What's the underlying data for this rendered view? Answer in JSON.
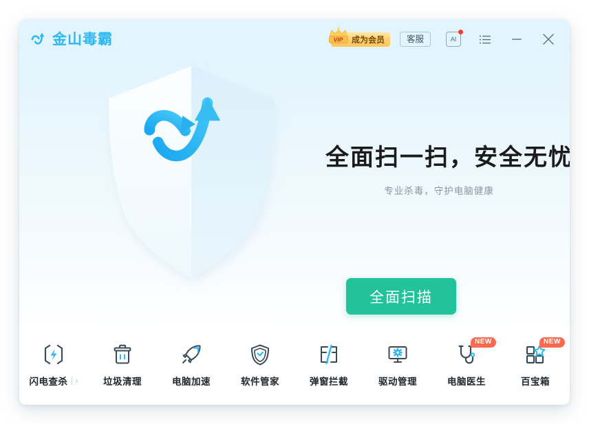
{
  "app": {
    "logo_text": "金山毒霸",
    "logo_icon": "duba-swoosh-icon",
    "accent_blue": "#2cb8f5",
    "accent_green": "#22c39a",
    "titlebar_bg": "#e2f4fd",
    "badge_red": "#fb6a4f"
  },
  "titlebar": {
    "vip_badge_text": "VIP",
    "vip_label": "成为会员",
    "support_label": "客服",
    "ai_label": "AI",
    "ai_has_notification": true,
    "menu_icon": "list-menu-icon",
    "minimize_icon": "minimize-icon",
    "close_icon": "close-icon"
  },
  "hero": {
    "title": "全面扫一扫，安全无忧",
    "subtitle": "专业杀毒，守护电脑健康",
    "scan_button": "全面扫描",
    "illustration": "shield-with-swoosh-arrow"
  },
  "toolbar": {
    "items": [
      {
        "label": "闪电查杀",
        "icon": "lightning-hexagon-icon",
        "badge": "",
        "has_chevron": true,
        "chevron": "›"
      },
      {
        "label": "垃圾清理",
        "icon": "trash-bin-icon",
        "badge": "",
        "has_chevron": false,
        "chevron": ""
      },
      {
        "label": "电脑加速",
        "icon": "rocket-icon",
        "badge": "",
        "has_chevron": false,
        "chevron": ""
      },
      {
        "label": "软件管家",
        "icon": "shield-check-icon",
        "badge": "",
        "has_chevron": false,
        "chevron": ""
      },
      {
        "label": "弹窗拦截",
        "icon": "popup-block-icon",
        "badge": "",
        "has_chevron": false,
        "chevron": ""
      },
      {
        "label": "驱动管理",
        "icon": "monitor-gear-icon",
        "badge": "",
        "has_chevron": false,
        "chevron": ""
      },
      {
        "label": "电脑医生",
        "icon": "stethoscope-icon",
        "badge": "NEW",
        "has_chevron": false,
        "chevron": ""
      },
      {
        "label": "百宝箱",
        "icon": "grid-star-icon",
        "badge": "NEW",
        "has_chevron": false,
        "chevron": ""
      }
    ]
  }
}
